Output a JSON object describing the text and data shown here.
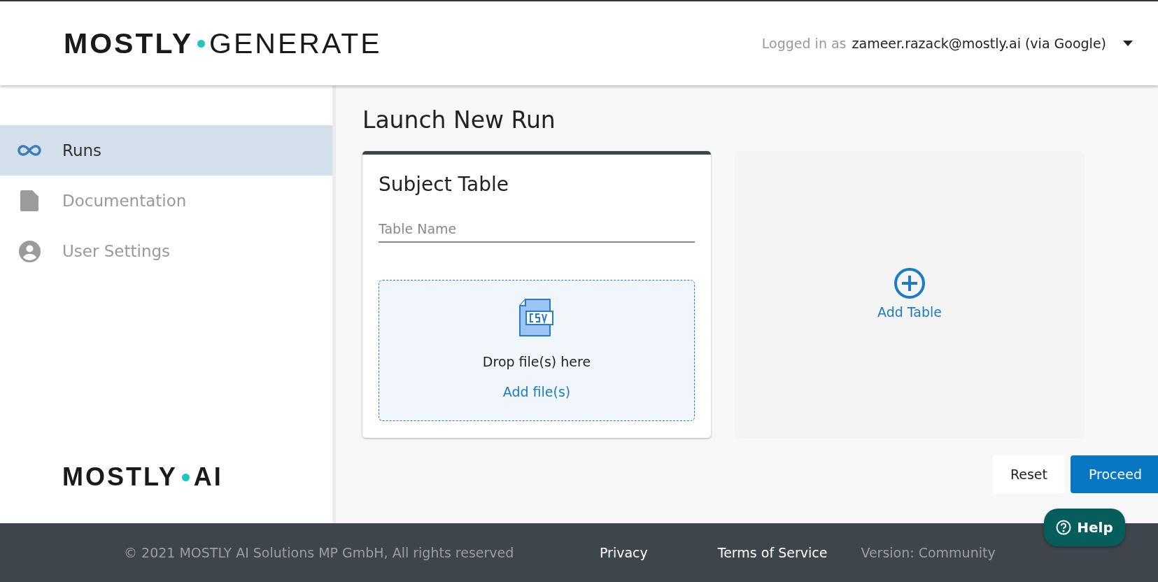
{
  "header": {
    "logo": {
      "first_word": "MOSTLY",
      "second_word": "GENERATE"
    },
    "login_prefix": "Logged in as",
    "login_user": "zameer.razack@mostly.ai (via Google)"
  },
  "sidebar": {
    "items": [
      {
        "label": "Runs",
        "kind": "runs",
        "selected": true
      },
      {
        "label": "Documentation",
        "kind": "doc",
        "selected": false
      },
      {
        "label": "User Settings",
        "kind": "user",
        "selected": false
      }
    ],
    "logo": {
      "first_word": "MOSTLY",
      "second_word": "AI"
    }
  },
  "main": {
    "title": "Launch New Run",
    "subject_table": {
      "title": "Subject Table",
      "placeholder": "Table Name",
      "drop_text": "Drop file(s) here",
      "add_link": "Add file(s)"
    },
    "add_table": {
      "label": "Add Table"
    },
    "buttons": [
      {
        "label": "Reset",
        "kind": "secondary"
      },
      {
        "label": "Proceed",
        "kind": "primary"
      }
    ]
  },
  "help": {
    "label": "Help"
  },
  "footer": {
    "copyright": "© 2021 MOSTLY AI Solutions MP GmbH, All rights reserved",
    "links": [
      "Privacy",
      "Terms of Service"
    ],
    "version": "Version: Community"
  }
}
